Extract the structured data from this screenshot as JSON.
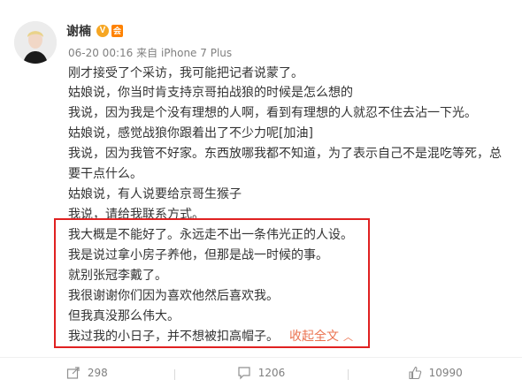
{
  "post": {
    "author": {
      "name": "谢楠",
      "verified_badge": "V",
      "member_badge": "会"
    },
    "meta": {
      "time": "06-20 00:16",
      "source_prefix": "来自",
      "device": "iPhone 7 Plus"
    },
    "lines": [
      "刚才接受了个采访，我可能把记者说蒙了。",
      "姑娘说，你当时肯支持京哥拍战狼的时候是怎么想的",
      "我说，因为我是个没有理想的人啊，看到有理想的人就忍不住去沾一下光。",
      "姑娘说，感觉战狼你跟着出了不少力呢[加油]",
      "我说，因为我管不好家。东西放哪我都不知道，为了表示自己不是混吃等死，总",
      "要干点什么。",
      "姑娘说，有人说要给京哥生猴子",
      "我说，请给我联系方式。",
      "我大概是不能好了。永远走不出一条伟光正的人设。",
      "我是说过拿小房子养他，但那是战一时候的事。",
      "就别张冠李戴了。",
      "我很谢谢你们因为喜欢他然后喜欢我。",
      "但我真没那么伟大。",
      "我过我的小日子，并不想被扣高帽子。"
    ],
    "collapse_label": "收起全文",
    "collapse_icon": "chevron-up-icon"
  },
  "actions": [
    {
      "name": "share",
      "icon": "share-icon",
      "count": "298"
    },
    {
      "name": "comment",
      "icon": "comment-icon",
      "count": "1206"
    },
    {
      "name": "like",
      "icon": "like-icon",
      "count": "10990"
    }
  ],
  "colors": {
    "text": "#333333",
    "meta": "#808080",
    "link": "#eb7350",
    "highlight_border": "#e02121",
    "verified": "#f6a623"
  }
}
